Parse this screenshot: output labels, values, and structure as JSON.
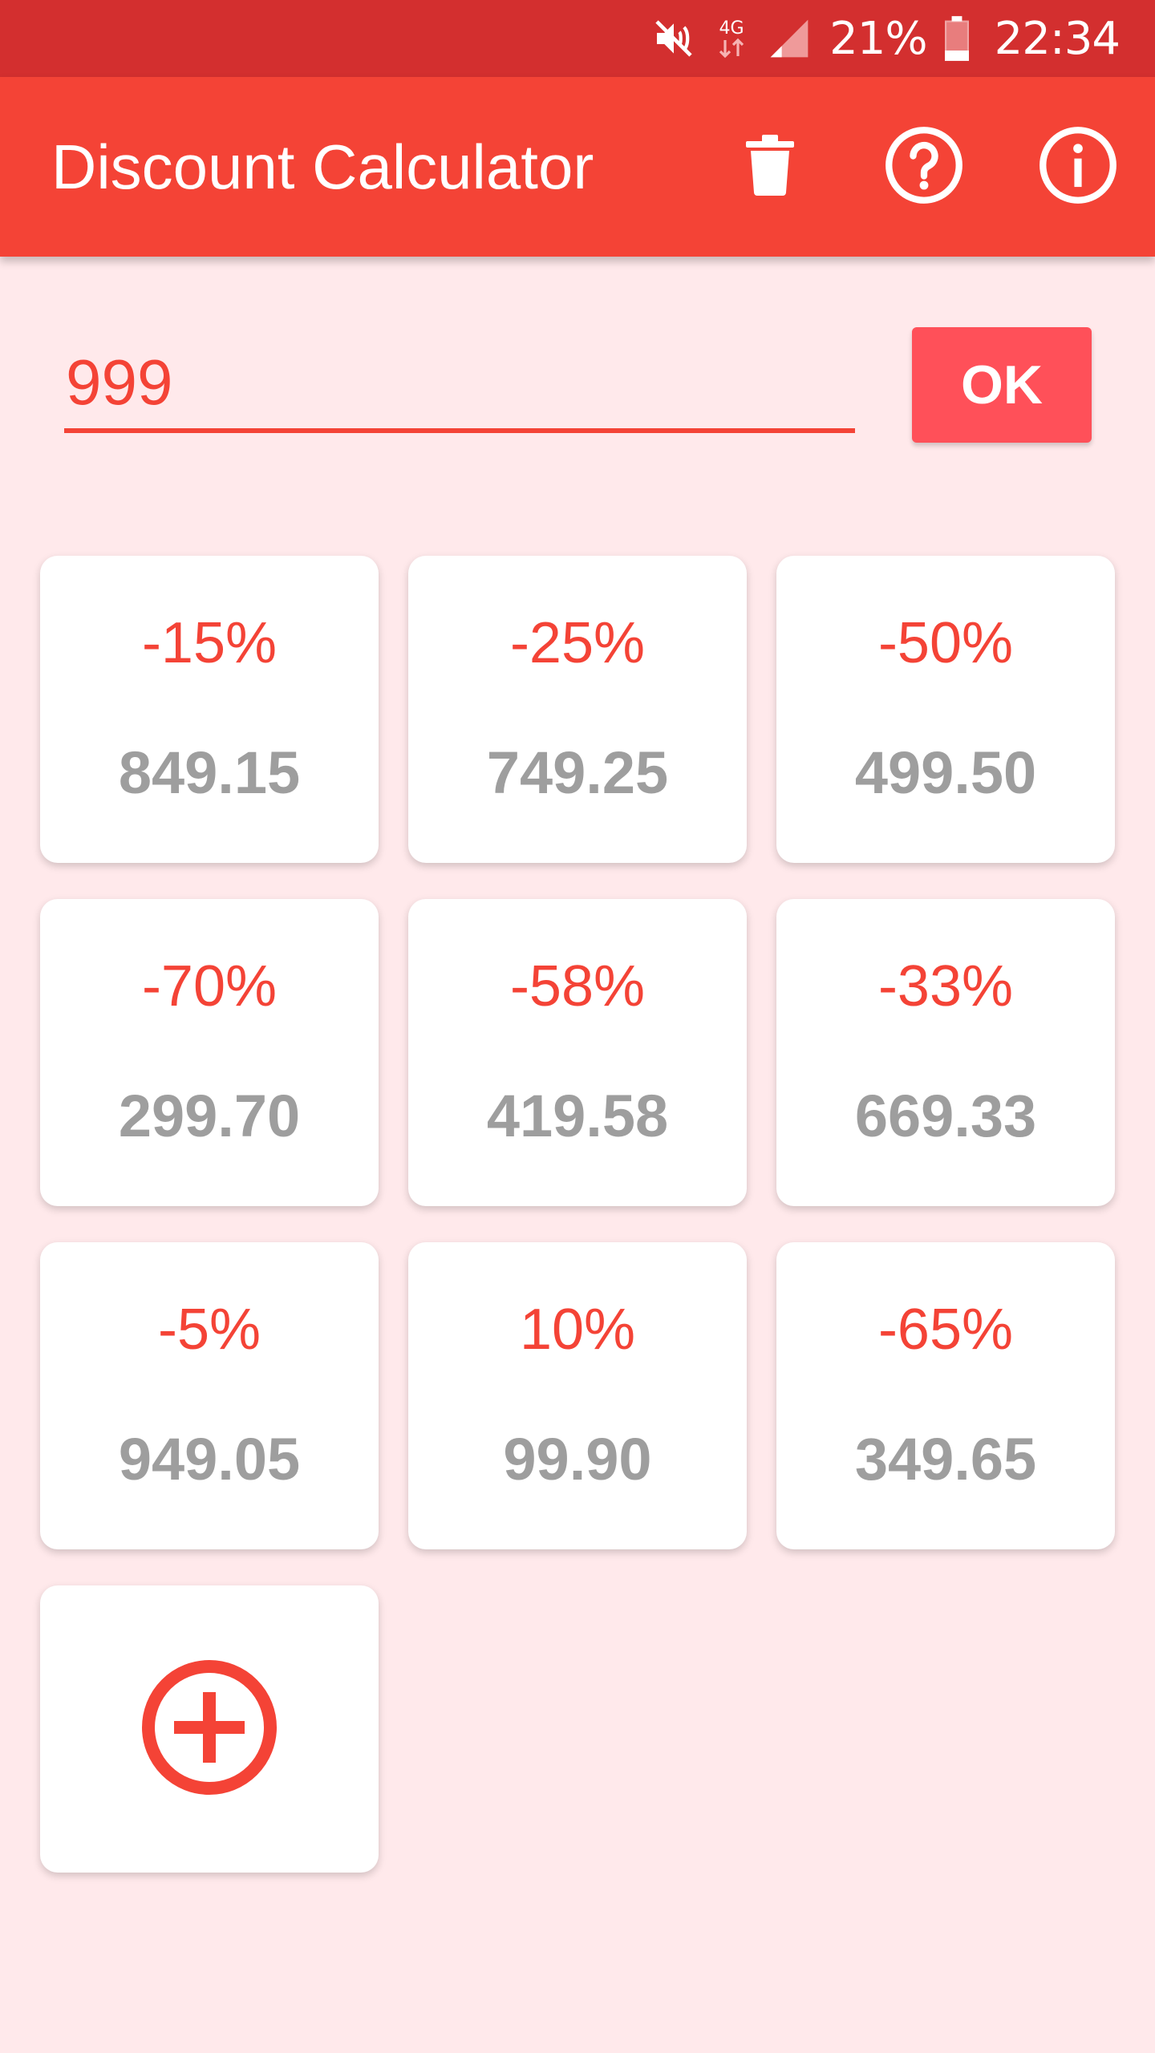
{
  "status_bar": {
    "network": "4G",
    "battery": "21%",
    "time": "22:34",
    "icons": [
      "mute-icon",
      "network-4g-icon",
      "signal-icon",
      "battery-icon"
    ]
  },
  "app_bar": {
    "title": "Discount Calculator",
    "actions": [
      "trash-icon",
      "help-icon",
      "info-icon"
    ],
    "color": "#F44336"
  },
  "input": {
    "value": "999",
    "ok_label": "OK"
  },
  "discounts": [
    {
      "percent": "-15%",
      "price": "849.15"
    },
    {
      "percent": "-25%",
      "price": "749.25"
    },
    {
      "percent": "-50%",
      "price": "499.50"
    },
    {
      "percent": "-70%",
      "price": "299.70"
    },
    {
      "percent": "-58%",
      "price": "419.58"
    },
    {
      "percent": "-33%",
      "price": "669.33"
    },
    {
      "percent": "-5%",
      "price": "949.05"
    },
    {
      "percent": "10%",
      "price": "99.90"
    },
    {
      "percent": "-65%",
      "price": "349.65"
    }
  ],
  "add_card": {
    "icon": "add-circle-icon"
  },
  "colors": {
    "status_bar": "#D32F2F",
    "accent": "#F44336",
    "ok_button": "#FF5059",
    "background": "#FFE9EB",
    "price_text": "#9E9E9E"
  }
}
